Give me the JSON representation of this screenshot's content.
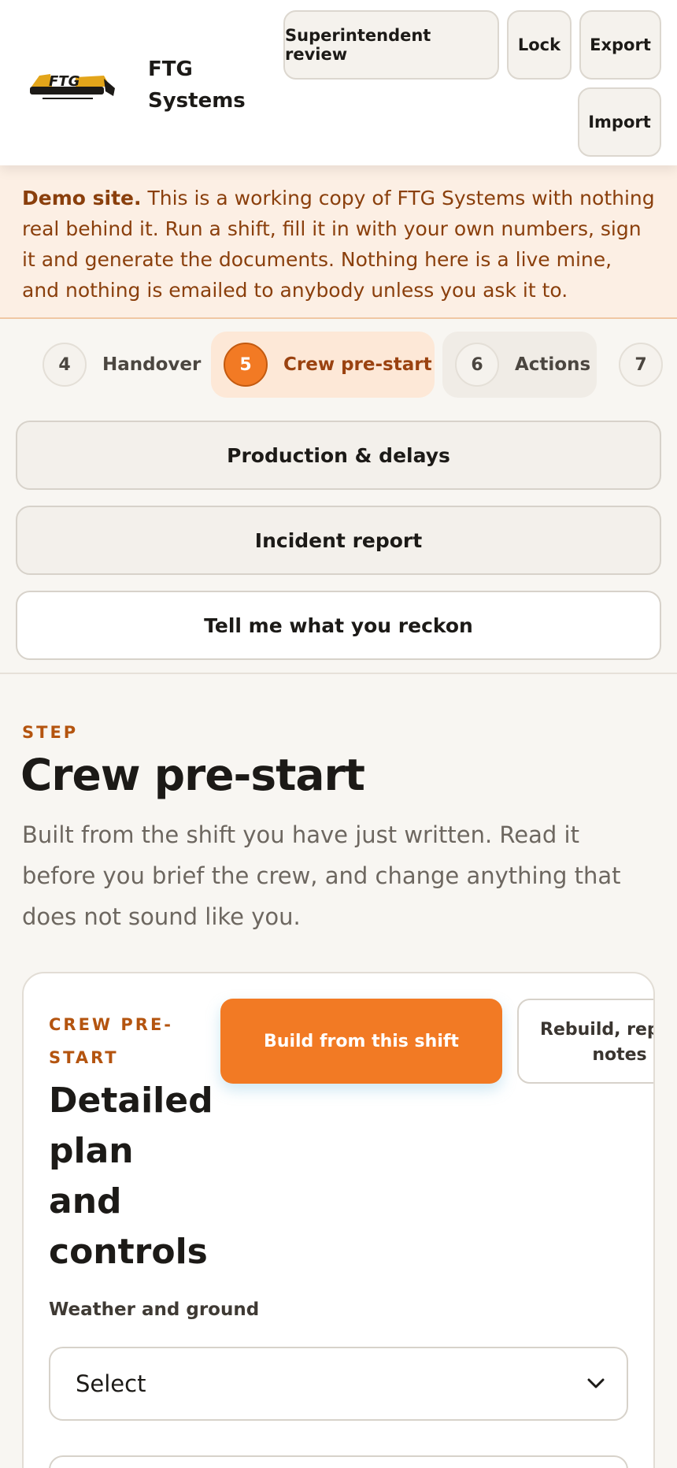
{
  "header": {
    "brand": "FTG Systems",
    "logo_text": "FTG",
    "buttons": {
      "review": "Superintendent review",
      "lock": "Lock",
      "export": "Export",
      "import": "Import"
    }
  },
  "banner": {
    "lead": "Demo site.",
    "text": " This is a working copy of FTG Systems with nothing real behind it. Run a shift, fill it in with your own numbers, sign it and generate the documents. Nothing here is a live mine, and nothing is emailed to anybody unless you ask it to."
  },
  "stepper": {
    "active_step": "5",
    "steps": [
      {
        "num": "4",
        "label": "Handover"
      },
      {
        "num": "5",
        "label": "Crew pre-start"
      },
      {
        "num": "6",
        "label": "Actions"
      },
      {
        "num": "7",
        "label": ""
      }
    ]
  },
  "nav_buttons": {
    "production": "Production & delays",
    "incident": "Incident report",
    "feedback": "Tell me what you reckon"
  },
  "step": {
    "eyebrow": "STEP",
    "title": "Crew pre-start",
    "description": "Built from the shift you have just written. Read it before you brief the crew, and change anything that does not sound like you."
  },
  "card": {
    "eyebrow": "CREW PRE-START",
    "title": "Detailed plan and controls",
    "build_button": "Build from this shift",
    "rebuild_button": "Rebuild, replace notes",
    "weather_label": "Weather and ground",
    "weather_value": "Select"
  },
  "colors": {
    "accent": "#f27a24",
    "accent_dark": "#b4540f",
    "banner_bg": "#fcefe4",
    "page_bg": "#f8f6f2"
  }
}
